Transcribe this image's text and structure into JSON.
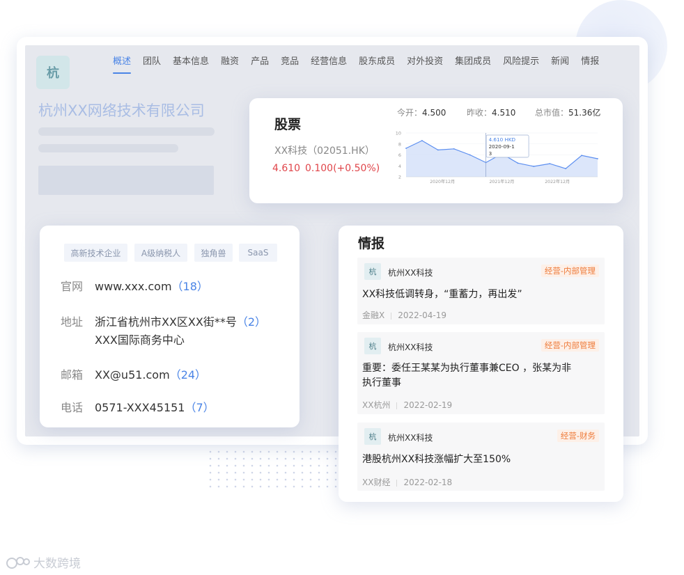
{
  "app": {
    "logo_char": "杭",
    "company_name": "杭州XX网络技术有限公司",
    "tabs": [
      "概述",
      "团队",
      "基本信息",
      "融资",
      "产品",
      "竞品",
      "经营信息",
      "股东成员",
      "对外投资",
      "集团成员",
      "风险提示",
      "新闻",
      "情报"
    ],
    "active_tab": 0
  },
  "stock": {
    "title": "股票",
    "name": "XX科技（02051.HK）",
    "price": "4.610",
    "change": "0.100(+0.50%)",
    "open_label": "今开：",
    "open_value": "4.500",
    "prev_label": "昨收：",
    "prev_value": "4.510",
    "cap_label": "总市值：",
    "cap_value": "51.36亿",
    "tooltip": {
      "line1": "4.610 HKD",
      "line2": "2020-09-1",
      "line3": "3"
    }
  },
  "chart_data": {
    "type": "area",
    "x_tick_labels": [
      "2020年12月",
      "2021年12月",
      "2022年12月"
    ],
    "y_ticks": [
      2,
      4,
      6,
      8,
      10
    ],
    "ylim": [
      2,
      10
    ],
    "values": [
      7.2,
      8.6,
      6.9,
      7.1,
      6.0,
      4.6,
      6.2,
      4.5,
      3.9,
      4.4,
      3.5,
      5.9,
      5.3
    ],
    "highlight_index": 5,
    "colors": {
      "line": "#5b8ef0",
      "fill": "#d6e2f9"
    }
  },
  "info": {
    "tags": [
      "高新技术企业",
      "A级纳税人",
      "独角兽",
      "SaaS"
    ],
    "website_label": "官网",
    "website_value": "www.xxx.com",
    "website_count": "（18）",
    "address_label": "地址",
    "address_line1": "浙江省杭州市XX区XX街**号",
    "address_count": "（2）",
    "address_line2": "XXX国际商务中心",
    "email_label": "邮箱",
    "email_value": "XX@u51.com",
    "email_count": "（24）",
    "phone_label": "电话",
    "phone_value": "0571-XXX45151",
    "phone_count": "（7）"
  },
  "news": {
    "title": "情报",
    "items": [
      {
        "icon_char": "杭",
        "source": "杭州XX科技",
        "tag": "经营-内部管理",
        "headline1": "XX科技低调转身，“重蓄力，再出发”",
        "headline2": "",
        "publisher": "金融X",
        "date": "2022-04-19"
      },
      {
        "icon_char": "杭",
        "source": "杭州XX科技",
        "tag": "经营-内部管理",
        "headline1": "重要：委任王某某为执行董事兼CEO ，张某为非",
        "headline2": "执行董事",
        "publisher": "XX杭州",
        "date": "2022-02-19"
      },
      {
        "icon_char": "杭",
        "source": "杭州XX科技",
        "tag": "经营-财务",
        "headline1": "港股杭州XX科技涨幅扩大至150%",
        "headline2": "",
        "publisher": "XX财经",
        "date": "2022-02-18"
      }
    ]
  },
  "watermark": {
    "text": "大数跨境"
  },
  "colors": {
    "accent": "#4a84e6",
    "price_red": "#e0454a",
    "tag_orange": "#ee7b3a"
  }
}
